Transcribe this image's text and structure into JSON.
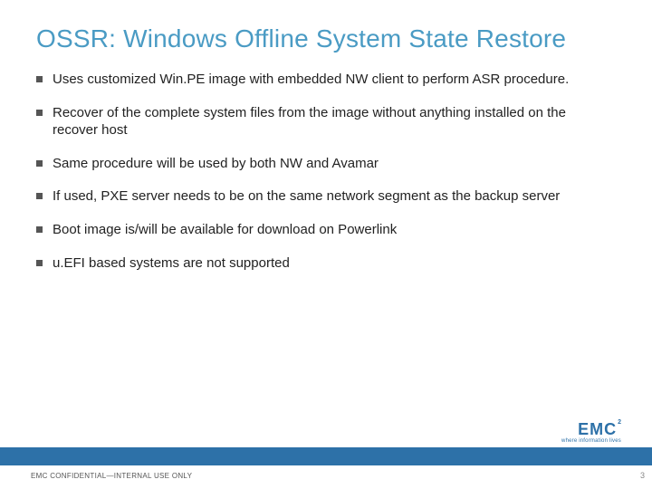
{
  "title": "OSSR: Windows Offline System State Restore",
  "bullets": [
    "Uses customized Win.PE image with embedded NW client to perform ASR procedure.",
    "Recover of the complete system files from the image without anything installed on the recover host",
    "Same procedure will be used by both NW and Avamar",
    "If used, PXE server needs to be on the same network segment as the backup server",
    "Boot image is/will be available for download on Powerlink",
    "u.EFI based systems are not supported"
  ],
  "footer": {
    "confidential": "EMC CONFIDENTIAL—INTERNAL USE ONLY",
    "page": "3",
    "logo_main": "EMC",
    "logo_sup": "2",
    "logo_tag": "where information lives"
  }
}
